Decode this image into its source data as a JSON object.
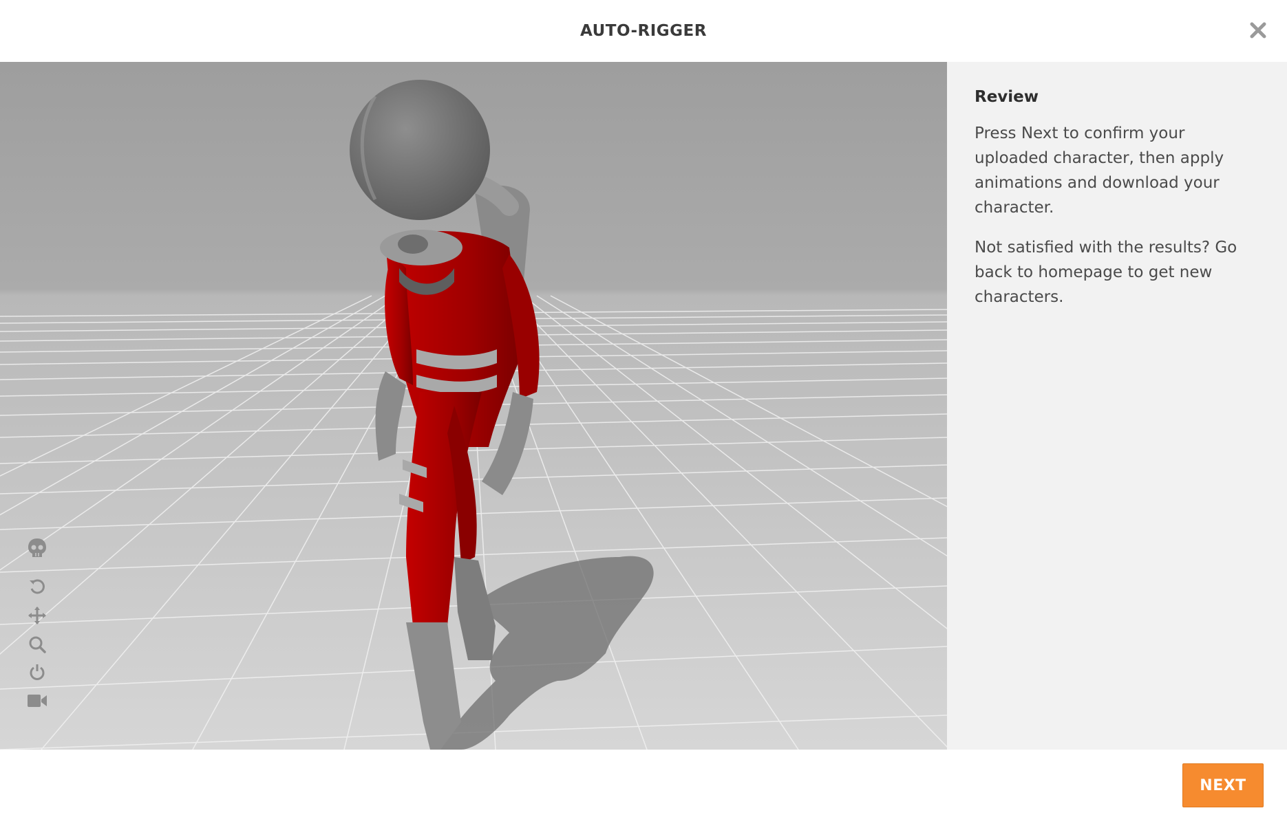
{
  "header": {
    "title": "AUTO-RIGGER"
  },
  "panel": {
    "heading": "Review",
    "paragraphs": [
      "Press Next to confirm your uploaded character, then apply animations and download your character.",
      "Not satisfied with the results? Go back to homepage to get new characters."
    ]
  },
  "footer": {
    "next_label": "NEXT"
  },
  "viewport_tools": [
    "skeleton-icon",
    "reset-icon",
    "pan-icon",
    "zoom-icon",
    "power-icon",
    "camera-icon"
  ],
  "colors": {
    "accent": "#f68b2f",
    "suit": "#b00000",
    "panel_bg": "#f2f2f2"
  }
}
